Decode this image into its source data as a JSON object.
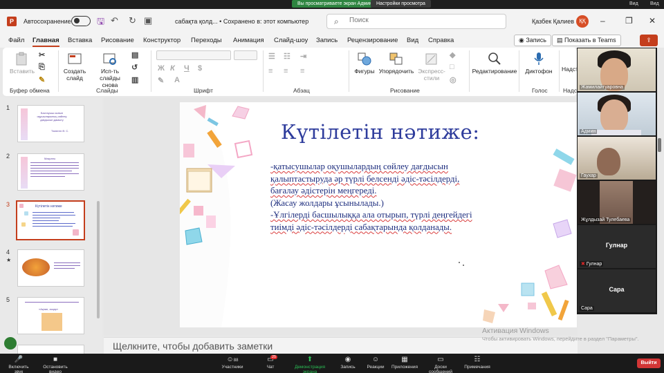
{
  "share_bar": {
    "viewing_label": "Вы просматриваете экран Админ",
    "view_settings": "Настройки просмотра",
    "vid_label": "Вид",
    "view_label": "Вид"
  },
  "titlebar": {
    "autosave_label": "Автосохранение",
    "doc_title": "сабақта қолд... • Сохранено в: этот компьютер",
    "search_placeholder": "Поиск",
    "user_name": "Қазбек Қалиев",
    "user_initials": "ҚҚ"
  },
  "menu": {
    "tabs": [
      "Файл",
      "Главная",
      "Вставка",
      "Рисование",
      "Конструктор",
      "Переходы",
      "Анимация",
      "Слайд-шоу",
      "Запись",
      "Рецензирование",
      "Вид",
      "Справка"
    ],
    "active": "Главная",
    "record_label": "Запись",
    "teams_label": "Показать в Teams"
  },
  "ribbon": {
    "paste_label": "Вставить",
    "create_slide_label": "Создать слайд",
    "reuse_label": "Исп-ть слайды снова",
    "shapes_label": "Фигуры",
    "arrange_label": "Упорядочить",
    "express_label": "Экспресс-стили",
    "editing_label": "Редактирование",
    "dictation_label": "Диктофон",
    "addins_label": "Надст",
    "groups": [
      "Буфер обмена",
      "Слайды",
      "Шрифт",
      "Абзац",
      "Рисование",
      "Голос",
      "Надст"
    ]
  },
  "thumbnails": [
    {
      "num": "1",
      "caption": "Бастауыш сынып оқушыларының сөйлеу дағдысын дамыту",
      "author": "Төлеген Ә. С."
    },
    {
      "num": "2",
      "caption": "Мақсаты"
    },
    {
      "num": "3",
      "caption": "Күтілетін нәтиже"
    },
    {
      "num": "4",
      "caption": ""
    },
    {
      "num": "5",
      "caption": "«Ақпан, асқар»"
    }
  ],
  "slide": {
    "title": "Күтілетін нәтиже:",
    "lines": [
      "-қатысушылар оқушылардың сөйлеу дағдысын",
      "қалыптастыруда әр түрлі белсенді әдіс-тәсілдерді,",
      "бағалау әдістерін меңгереді.",
      "(Жасау жолдары ұсынылады.)",
      "-Ұлгілерді басшылыққа ала отырып, түрлі деңгейдегі",
      "тиімді әдіс-тәсілдерді сабақтарында  қолданады."
    ]
  },
  "notes_placeholder": "Щелкните, чтобы добавить заметки",
  "watermark": {
    "line1": "Активация Windows",
    "line2": "Чтобы активировать Windows, перейдите в раздел \"Параметры\"."
  },
  "participants": [
    {
      "name": "Жамилайтуаровна",
      "has_video": true
    },
    {
      "name": "Админ",
      "has_video": true
    },
    {
      "name": "Гаухар",
      "has_video": true
    },
    {
      "name": "Жұлдызай Тулебаева",
      "has_video": true
    },
    {
      "name": "Гулнар",
      "has_video": false
    },
    {
      "name": "Сара",
      "has_video": false
    }
  ],
  "zoom_bar": {
    "mute_label": "Включить звук",
    "video_label": "Остановить видео",
    "participants_label": "Участники",
    "participants_count": "88",
    "chat_label": "Чат",
    "chat_badge": "25",
    "share_label": "Демонстрация экрана",
    "record_label": "Запись",
    "reactions_label": "Реакции",
    "apps_label": "Приложения",
    "whiteboard_label": "Доски сообщений",
    "notes_label": "Примечания",
    "leave_label": "Выйти"
  },
  "colors": {
    "ppt_accent": "#c43e1c",
    "slide_title": "#2e3c9c",
    "slide_body": "#1d2d7e",
    "zoom_green": "#2bbf55",
    "leave_red": "#d23636"
  }
}
